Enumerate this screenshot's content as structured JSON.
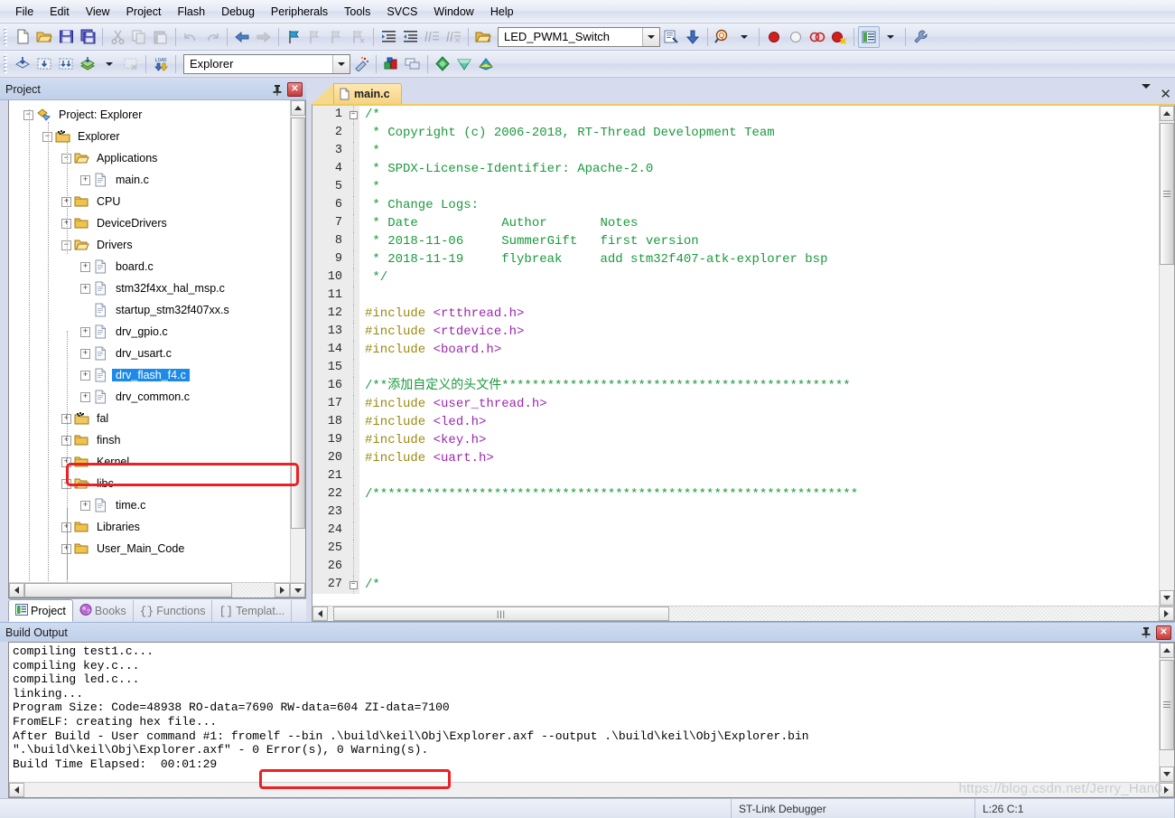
{
  "menu": {
    "items": [
      {
        "label": "File",
        "accel": "F"
      },
      {
        "label": "Edit",
        "accel": "E"
      },
      {
        "label": "View",
        "accel": "V"
      },
      {
        "label": "Project",
        "accel": "P"
      },
      {
        "label": "Flash",
        "accel": "s"
      },
      {
        "label": "Debug",
        "accel": "D"
      },
      {
        "label": "Peripherals",
        "accel": "i"
      },
      {
        "label": "Tools",
        "accel": "T"
      },
      {
        "label": "SVCS",
        "accel": "S"
      },
      {
        "label": "Window",
        "accel": "W"
      },
      {
        "label": "Help",
        "accel": "H"
      }
    ]
  },
  "toolbar1": {
    "buttons": [
      {
        "name": "new-file",
        "title": "New"
      },
      {
        "name": "open-file",
        "title": "Open"
      },
      {
        "name": "save",
        "title": "Save"
      },
      {
        "name": "save-all",
        "title": "Save All"
      },
      {
        "name": "cut",
        "title": "Cut"
      },
      {
        "name": "copy",
        "title": "Copy"
      },
      {
        "name": "paste",
        "title": "Paste"
      },
      {
        "name": "undo",
        "title": "Undo"
      },
      {
        "name": "redo",
        "title": "Redo"
      },
      {
        "name": "navigate-back",
        "title": "Back"
      },
      {
        "name": "navigate-forward",
        "title": "Forward"
      },
      {
        "name": "bookmark-toggle",
        "title": "Insert/Remove Bookmark"
      },
      {
        "name": "bookmark-prev",
        "title": "Previous Bookmark"
      },
      {
        "name": "bookmark-next",
        "title": "Next Bookmark"
      },
      {
        "name": "bookmark-clear",
        "title": "Clear All Bookmarks"
      },
      {
        "name": "indent-right",
        "title": "Indent"
      },
      {
        "name": "indent-left",
        "title": "Outdent"
      },
      {
        "name": "comment-lines",
        "title": "Comment"
      },
      {
        "name": "uncomment-lines",
        "title": "Uncomment"
      },
      {
        "name": "open-project",
        "title": "Open Project"
      }
    ],
    "target_value": "LED_PWM1_Switch",
    "right_buttons": [
      {
        "name": "target-options",
        "title": "Options for Target"
      },
      {
        "name": "download-to-flash",
        "title": "Download"
      },
      {
        "name": "find-in-files",
        "title": "Find in Files"
      },
      {
        "name": "breakpoint-insert",
        "title": "Insert/Remove Breakpoint"
      },
      {
        "name": "breakpoint-disable",
        "title": "Enable/Disable Breakpoint"
      },
      {
        "name": "breakpoint-disable-all",
        "title": "Disable All Breakpoints"
      },
      {
        "name": "breakpoint-kill-all",
        "title": "Kill All Breakpoints"
      },
      {
        "name": "manage-windows",
        "title": "Manage Windows"
      },
      {
        "name": "configure-tools",
        "title": "Configure"
      }
    ]
  },
  "toolbar2": {
    "buttons": [
      {
        "name": "translate-file",
        "title": "Translate"
      },
      {
        "name": "build-target",
        "title": "Build"
      },
      {
        "name": "rebuild-all",
        "title": "Rebuild"
      },
      {
        "name": "batch-build",
        "title": "Batch Build"
      },
      {
        "name": "stop-build",
        "title": "Stop Build"
      },
      {
        "name": "load-to-flash",
        "title": "Load"
      }
    ],
    "target_select_value": "Explorer",
    "right_buttons": [
      {
        "name": "target-options-wizard",
        "title": "Options"
      },
      {
        "name": "manage-project-items",
        "title": "Manage Project Items"
      },
      {
        "name": "manage-multi-project",
        "title": "Multi-Project"
      },
      {
        "name": "pack-installer",
        "title": "Pack Installer"
      },
      {
        "name": "manage-run-time",
        "title": "Manage Run-Time Environment"
      },
      {
        "name": "select-software-packs",
        "title": "Select Software Packs"
      }
    ]
  },
  "project_panel": {
    "title": "Project",
    "tree": [
      {
        "label": "Project: Explorer",
        "depth": 0,
        "expander": "-",
        "icon": "project-icon"
      },
      {
        "label": "Explorer",
        "depth": 1,
        "expander": "-",
        "icon": "target-icon"
      },
      {
        "label": "Applications",
        "depth": 2,
        "expander": "-",
        "icon": "folder-open-icon"
      },
      {
        "label": "main.c",
        "depth": 3,
        "expander": "+",
        "icon": "file-icon"
      },
      {
        "label": "CPU",
        "depth": 2,
        "expander": "+",
        "icon": "folder-icon"
      },
      {
        "label": "DeviceDrivers",
        "depth": 2,
        "expander": "+",
        "icon": "folder-icon"
      },
      {
        "label": "Drivers",
        "depth": 2,
        "expander": "-",
        "icon": "folder-open-icon"
      },
      {
        "label": "board.c",
        "depth": 3,
        "expander": "+",
        "icon": "file-icon"
      },
      {
        "label": "stm32f4xx_hal_msp.c",
        "depth": 3,
        "expander": "+",
        "icon": "file-icon"
      },
      {
        "label": "startup_stm32f407xx.s",
        "depth": 3,
        "expander": "",
        "icon": "file-icon"
      },
      {
        "label": "drv_gpio.c",
        "depth": 3,
        "expander": "+",
        "icon": "file-icon"
      },
      {
        "label": "drv_usart.c",
        "depth": 3,
        "expander": "+",
        "icon": "file-icon"
      },
      {
        "label": "drv_flash_f4.c",
        "depth": 3,
        "expander": "+",
        "icon": "file-icon",
        "selected": true
      },
      {
        "label": "drv_common.c",
        "depth": 3,
        "expander": "+",
        "icon": "file-icon"
      },
      {
        "label": "fal",
        "depth": 2,
        "expander": "+",
        "icon": "target-icon"
      },
      {
        "label": "finsh",
        "depth": 2,
        "expander": "+",
        "icon": "folder-icon"
      },
      {
        "label": "Kernel",
        "depth": 2,
        "expander": "+",
        "icon": "folder-icon"
      },
      {
        "label": "libc",
        "depth": 2,
        "expander": "-",
        "icon": "folder-open-icon"
      },
      {
        "label": "time.c",
        "depth": 3,
        "expander": "+",
        "icon": "file-icon"
      },
      {
        "label": "Libraries",
        "depth": 2,
        "expander": "+",
        "icon": "folder-icon"
      },
      {
        "label": "User_Main_Code",
        "depth": 2,
        "expander": "+",
        "icon": "folder-icon"
      }
    ],
    "tabs": [
      {
        "label": "Project",
        "icon": "project-tab-icon",
        "active": true
      },
      {
        "label": "Books",
        "icon": "books-tab-icon",
        "active": false
      },
      {
        "label": "Functions",
        "icon": "functions-tab-icon",
        "active": false
      },
      {
        "label": "Templat...",
        "icon": "templates-tab-icon",
        "active": false
      }
    ]
  },
  "editor": {
    "tab_label": "main.c",
    "lines": [
      {
        "n": 1,
        "fold": "-",
        "segs": [
          {
            "t": "/*",
            "c": "comment"
          }
        ]
      },
      {
        "n": 2,
        "fold": "",
        "segs": [
          {
            "t": " * Copyright (c) 2006-2018, RT-Thread Development Team",
            "c": "comment"
          }
        ]
      },
      {
        "n": 3,
        "fold": "",
        "segs": [
          {
            "t": " *",
            "c": "comment"
          }
        ]
      },
      {
        "n": 4,
        "fold": "",
        "segs": [
          {
            "t": " * SPDX-License-Identifier: Apache-2.0",
            "c": "comment"
          }
        ]
      },
      {
        "n": 5,
        "fold": "",
        "segs": [
          {
            "t": " *",
            "c": "comment"
          }
        ]
      },
      {
        "n": 6,
        "fold": "",
        "segs": [
          {
            "t": " * Change Logs:",
            "c": "comment"
          }
        ]
      },
      {
        "n": 7,
        "fold": "",
        "segs": [
          {
            "t": " * Date           Author       Notes",
            "c": "comment"
          }
        ]
      },
      {
        "n": 8,
        "fold": "",
        "segs": [
          {
            "t": " * 2018-11-06     SummerGift   first version",
            "c": "comment"
          }
        ]
      },
      {
        "n": 9,
        "fold": "",
        "segs": [
          {
            "t": " * 2018-11-19     flybreak     add stm32f407-atk-explorer bsp",
            "c": "comment"
          }
        ]
      },
      {
        "n": 10,
        "fold": "",
        "segs": [
          {
            "t": " */",
            "c": "comment"
          }
        ]
      },
      {
        "n": 11,
        "fold": "",
        "segs": []
      },
      {
        "n": 12,
        "fold": "",
        "segs": [
          {
            "t": "#include ",
            "c": "pre"
          },
          {
            "t": "<rtthread.h>",
            "c": "str"
          }
        ]
      },
      {
        "n": 13,
        "fold": "",
        "segs": [
          {
            "t": "#include ",
            "c": "pre"
          },
          {
            "t": "<rtdevice.h>",
            "c": "str"
          }
        ]
      },
      {
        "n": 14,
        "fold": "",
        "segs": [
          {
            "t": "#include ",
            "c": "pre"
          },
          {
            "t": "<board.h>",
            "c": "str"
          }
        ]
      },
      {
        "n": 15,
        "fold": "",
        "segs": []
      },
      {
        "n": 16,
        "fold": "",
        "segs": [
          {
            "t": "/**添加自定义的头文件**********************************************",
            "c": "comment"
          }
        ]
      },
      {
        "n": 17,
        "fold": "",
        "segs": [
          {
            "t": "#include ",
            "c": "pre"
          },
          {
            "t": "<user_thread.h>",
            "c": "str"
          }
        ]
      },
      {
        "n": 18,
        "fold": "",
        "segs": [
          {
            "t": "#include ",
            "c": "pre"
          },
          {
            "t": "<led.h>",
            "c": "str"
          }
        ]
      },
      {
        "n": 19,
        "fold": "",
        "segs": [
          {
            "t": "#include ",
            "c": "pre"
          },
          {
            "t": "<key.h>",
            "c": "str"
          }
        ]
      },
      {
        "n": 20,
        "fold": "",
        "segs": [
          {
            "t": "#include ",
            "c": "pre"
          },
          {
            "t": "<uart.h>",
            "c": "str"
          }
        ]
      },
      {
        "n": 21,
        "fold": "",
        "segs": []
      },
      {
        "n": 22,
        "fold": "",
        "segs": [
          {
            "t": "/****************************************************************",
            "c": "comment"
          }
        ]
      },
      {
        "n": 23,
        "fold": "",
        "segs": []
      },
      {
        "n": 24,
        "fold": "",
        "segs": []
      },
      {
        "n": 25,
        "fold": "",
        "segs": []
      },
      {
        "n": 26,
        "fold": "",
        "segs": []
      },
      {
        "n": 27,
        "fold": "-",
        "segs": [
          {
            "t": "/*",
            "c": "comment"
          }
        ]
      }
    ]
  },
  "build_output": {
    "title": "Build Output",
    "lines": [
      "compiling test1.c...",
      "compiling key.c...",
      "compiling led.c...",
      "linking...",
      "Program Size: Code=48938 RO-data=7690 RW-data=604 ZI-data=7100",
      "FromELF: creating hex file...",
      "After Build - User command #1: fromelf --bin .\\build\\keil\\Obj\\Explorer.axf --output .\\build\\keil\\Obj\\Explorer.bin",
      "\".\\build\\keil\\Obj\\Explorer.axf\" - 0 Error(s), 0 Warning(s).",
      "Build Time Elapsed:  00:01:29"
    ],
    "highlighted_text": "0 Error(s), 0 Warning(s)."
  },
  "statusbar": {
    "debugger": "ST-Link Debugger",
    "position": "L:26 C:1"
  },
  "watermark": "https://blog.csdn.net/Jerry_Han0",
  "colors": {
    "selection": "#1c8ae8",
    "highlight_box": "#ed2024",
    "comment": "#1a9a3c",
    "preprocessor": "#9a8b10",
    "string": "#9c27b0",
    "tab_active": "#f6d382"
  }
}
